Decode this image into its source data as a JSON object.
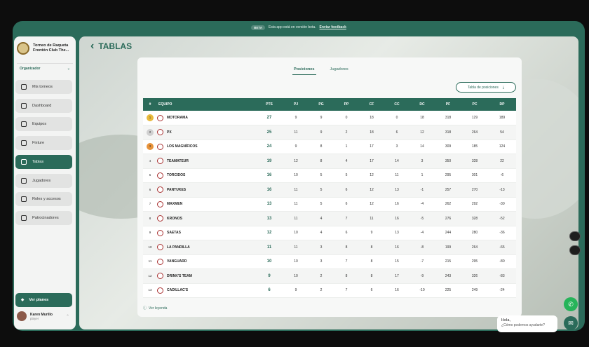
{
  "banner": {
    "badge": "BETA",
    "message": "Esta app está en versión beta.",
    "feedback": "Enviar feedback"
  },
  "brand": {
    "name": "Torneo de Raqueta Frontón Club The..."
  },
  "role": {
    "label": "Organizador"
  },
  "nav": [
    {
      "label": "Mis torneos",
      "icon": "trophy-icon"
    },
    {
      "label": "Dashboard",
      "icon": "trophy-icon"
    },
    {
      "label": "Equipos",
      "icon": "users-icon"
    },
    {
      "label": "Fixture",
      "icon": "calendar-icon"
    },
    {
      "label": "Tablas",
      "icon": "table-icon",
      "active": true
    },
    {
      "label": "Jugadores",
      "icon": "user-icon"
    },
    {
      "label": "Roles y accesos",
      "icon": "roles-icon"
    },
    {
      "label": "Patrocinadores",
      "icon": "megaphone-icon"
    }
  ],
  "plans": {
    "label": "Ver planes"
  },
  "user": {
    "name": "Karen Murillo",
    "role": "player"
  },
  "page": {
    "title": "TABLAS"
  },
  "tabs": [
    {
      "label": "Posiciones",
      "active": true
    },
    {
      "label": "Jugadores",
      "active": false
    }
  ],
  "positions_button": {
    "label": "Tabla de posiciones"
  },
  "table": {
    "headers": [
      "#",
      "EQUIPO",
      "PTS",
      "PJ",
      "PG",
      "PP",
      "CF",
      "CC",
      "DC",
      "PF",
      "PC",
      "DP"
    ],
    "rows": [
      [
        "1",
        "MOTORAMA",
        "27",
        "9",
        "9",
        "0",
        "18",
        "0",
        "18",
        "318",
        "129",
        "189"
      ],
      [
        "2",
        "PX",
        "25",
        "11",
        "9",
        "2",
        "18",
        "6",
        "12",
        "318",
        "264",
        "54"
      ],
      [
        "3",
        "LOS MAGNÍFICOS",
        "24",
        "9",
        "8",
        "1",
        "17",
        "3",
        "14",
        "309",
        "185",
        "124"
      ],
      [
        "4",
        "TEAMATEUR",
        "19",
        "12",
        "8",
        "4",
        "17",
        "14",
        "3",
        "350",
        "328",
        "22"
      ],
      [
        "5",
        "TORCIDOS",
        "16",
        "10",
        "5",
        "5",
        "12",
        "11",
        "1",
        "295",
        "301",
        "-6"
      ],
      [
        "6",
        "PANTUKES",
        "16",
        "11",
        "5",
        "6",
        "12",
        "13",
        "-1",
        "257",
        "270",
        "-13"
      ],
      [
        "7",
        "MAXMEN",
        "13",
        "11",
        "5",
        "6",
        "12",
        "16",
        "-4",
        "262",
        "292",
        "-30"
      ],
      [
        "8",
        "KRONOS",
        "13",
        "11",
        "4",
        "7",
        "11",
        "16",
        "-5",
        "276",
        "328",
        "-52"
      ],
      [
        "9",
        "SAETAS",
        "12",
        "10",
        "4",
        "6",
        "9",
        "13",
        "-4",
        "244",
        "280",
        "-36"
      ],
      [
        "10",
        "LA PANDILLA",
        "11",
        "11",
        "3",
        "8",
        "8",
        "16",
        "-8",
        "199",
        "264",
        "-65"
      ],
      [
        "11",
        "VANGUARD",
        "10",
        "10",
        "3",
        "7",
        "8",
        "15",
        "-7",
        "215",
        "295",
        "-80"
      ],
      [
        "12",
        "DRINK'S TEAM",
        "9",
        "10",
        "2",
        "8",
        "8",
        "17",
        "-9",
        "243",
        "326",
        "-83"
      ],
      [
        "13",
        "CADILLAC'S",
        "6",
        "9",
        "2",
        "7",
        "6",
        "16",
        "-10",
        "225",
        "249",
        "-24"
      ]
    ]
  },
  "legend": {
    "label": "Ver leyenda"
  },
  "chat": {
    "greeting": "Hola,",
    "question": "¿Cómo podemos ayudarte?"
  },
  "colors": {
    "primary": "#2b6b5a",
    "gold": "#e8b93b",
    "silver": "#d0d0d0",
    "bronze": "#e7923a"
  }
}
